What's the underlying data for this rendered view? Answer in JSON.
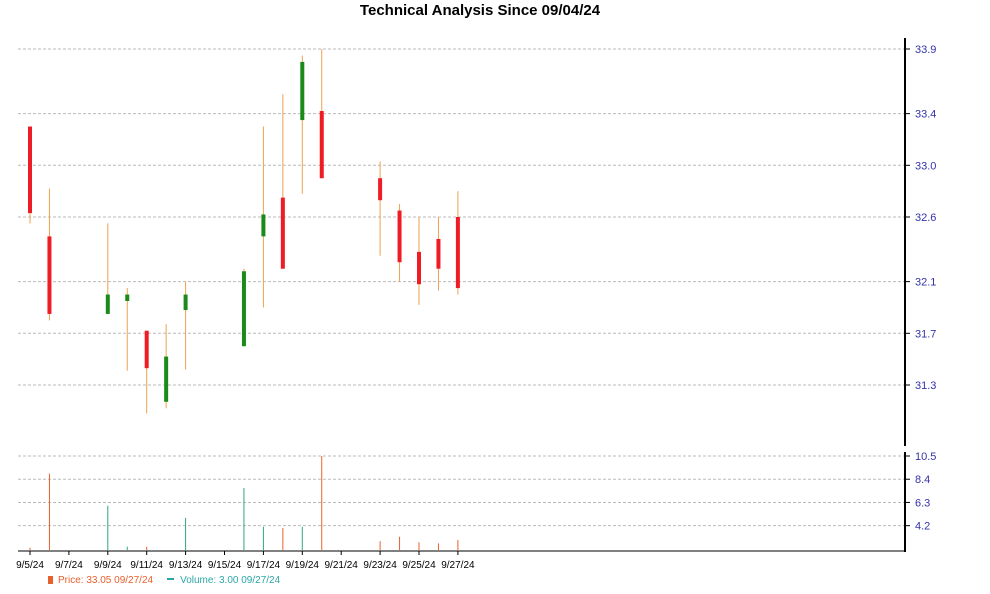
{
  "chart_data": {
    "type": "candlestick",
    "title": "Technical Analysis Since 09/04/24",
    "x_tick_labels": [
      "9/5/24",
      "9/7/24",
      "9/9/24",
      "9/11/24",
      "9/13/24",
      "9/15/24",
      "9/17/24",
      "9/19/24",
      "9/21/24",
      "9/23/24",
      "9/25/24",
      "9/27/24"
    ],
    "price_ticks": [
      "33.9",
      "33.4",
      "33.0",
      "32.6",
      "32.1",
      "31.7",
      "31.3"
    ],
    "volume_ticks": [
      "10.5",
      "8.4",
      "6.3",
      "4.2"
    ],
    "price_range": [
      30.8,
      33.9
    ],
    "volume_range": [
      2.0,
      10.5
    ],
    "days": [
      {
        "date": "9/5/24",
        "open": 33.3,
        "high": 33.3,
        "low": 32.55,
        "close": 32.63,
        "volume": 2.2
      },
      {
        "date": "9/6/24",
        "open": 32.45,
        "high": 32.82,
        "low": 31.8,
        "close": 31.85,
        "volume": 8.9
      },
      {
        "date": "9/9/24",
        "open": 31.85,
        "high": 32.55,
        "low": 31.85,
        "close": 32.0,
        "volume": 6.0
      },
      {
        "date": "9/10/24",
        "open": 31.95,
        "high": 32.05,
        "low": 31.41,
        "close": 32.0,
        "volume": 2.3
      },
      {
        "date": "9/11/24",
        "open": 31.72,
        "high": 31.72,
        "low": 31.08,
        "close": 31.43,
        "volume": 2.3
      },
      {
        "date": "9/12/24",
        "open": 31.17,
        "high": 31.77,
        "low": 31.12,
        "close": 31.52,
        "volume": 2.0
      },
      {
        "date": "9/13/24",
        "open": 31.88,
        "high": 32.1,
        "low": 31.42,
        "close": 32.0,
        "volume": 4.9
      },
      {
        "date": "9/16/24",
        "open": 31.6,
        "high": 32.2,
        "low": 31.6,
        "close": 32.18,
        "volume": 7.6
      },
      {
        "date": "9/17/24",
        "open": 32.45,
        "high": 33.3,
        "low": 31.9,
        "close": 32.62,
        "volume": 4.1
      },
      {
        "date": "9/18/24",
        "open": 32.75,
        "high": 33.55,
        "low": 32.2,
        "close": 32.2,
        "volume": 4.0
      },
      {
        "date": "9/19/24",
        "open": 33.35,
        "high": 33.85,
        "low": 32.78,
        "close": 33.8,
        "volume": 4.1
      },
      {
        "date": "9/20/24",
        "open": 33.42,
        "high": 33.9,
        "low": 32.9,
        "close": 32.9,
        "volume": 10.5
      },
      {
        "date": "9/23/24",
        "open": 32.9,
        "high": 33.03,
        "low": 32.3,
        "close": 32.73,
        "volume": 2.8
      },
      {
        "date": "9/24/24",
        "open": 32.65,
        "high": 32.7,
        "low": 32.1,
        "close": 32.25,
        "volume": 3.2
      },
      {
        "date": "9/25/24",
        "open": 32.33,
        "high": 32.6,
        "low": 31.92,
        "close": 32.08,
        "volume": 2.7
      },
      {
        "date": "9/26/24",
        "open": 32.43,
        "high": 32.6,
        "low": 32.03,
        "close": 32.2,
        "volume": 2.6
      },
      {
        "date": "9/27/24",
        "open": 32.6,
        "high": 32.8,
        "low": 32.0,
        "close": 32.05,
        "volume": 2.9
      }
    ],
    "colors": {
      "up": "#1a8a1a",
      "down": "#ee1c24",
      "wick": "#f0a050",
      "grid": "#bbbbbb",
      "axis": "#000000",
      "tick_label": "#3333aa",
      "vol_down": "#e8602c",
      "vol_up": "#2ba87a"
    },
    "grid": true
  },
  "legend": {
    "price": "Price: 33.05  09/27/24",
    "volume": "Volume: 3.00  09/27/24"
  }
}
